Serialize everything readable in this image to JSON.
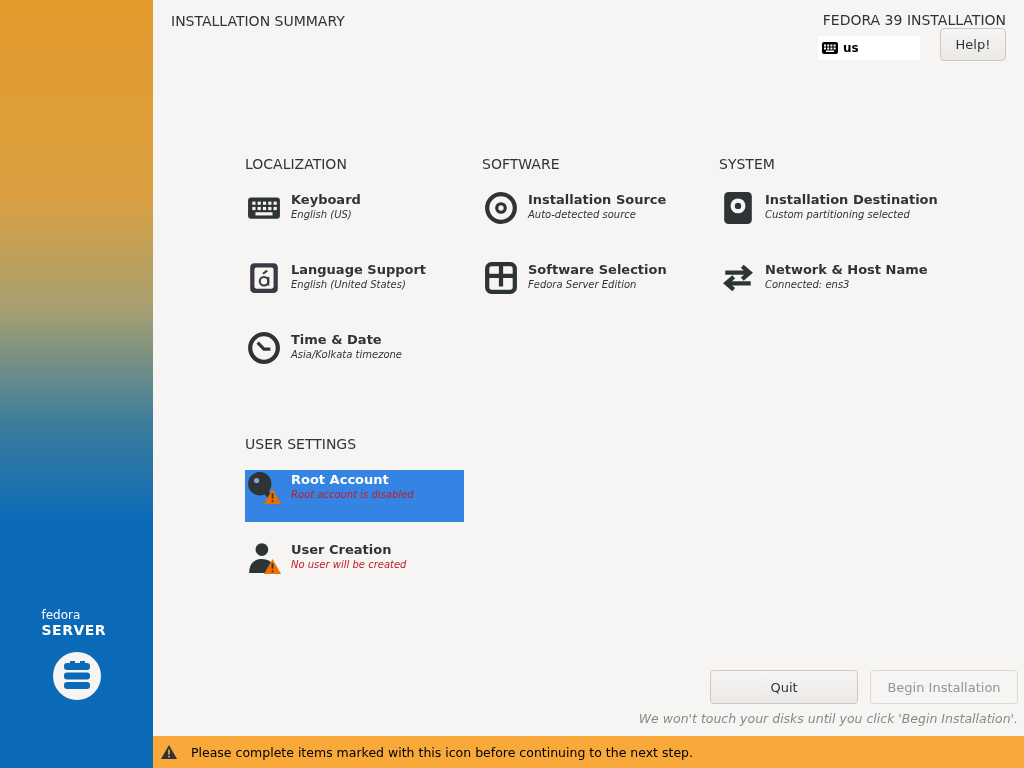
{
  "header": {
    "title": "INSTALLATION SUMMARY",
    "product": "FEDORA 39 INSTALLATION",
    "keyboard_layout": "us",
    "help_button": "Help!"
  },
  "sidebar": {
    "brand": "fedora",
    "edition": "SERVER"
  },
  "sections": [
    {
      "title": "LOCALIZATION",
      "spokes": [
        {
          "kind": "keyboard",
          "title": "Keyboard",
          "status": "English (US)",
          "warning": false,
          "selected": false
        },
        {
          "kind": "language",
          "title": "Language Support",
          "status": "English (United States)",
          "warning": false,
          "selected": false
        },
        {
          "kind": "clock",
          "title": "Time & Date",
          "status": "Asia/Kolkata timezone",
          "warning": false,
          "selected": false
        }
      ]
    },
    {
      "title": "SOFTWARE",
      "spokes": [
        {
          "kind": "disc",
          "title": "Installation Source",
          "status": "Auto-detected source",
          "warning": false,
          "selected": false
        },
        {
          "kind": "package",
          "title": "Software Selection",
          "status": "Fedora Server Edition",
          "warning": false,
          "selected": false
        }
      ]
    },
    {
      "title": "SYSTEM",
      "spokes": [
        {
          "kind": "disk",
          "title": "Installation Destination",
          "status": "Custom partitioning selected",
          "warning": false,
          "selected": false
        },
        {
          "kind": "network",
          "title": "Network & Host Name",
          "status": "Connected: ens3",
          "warning": false,
          "selected": false
        }
      ]
    },
    {
      "title": "USER SETTINGS",
      "spokes": [
        {
          "kind": "key",
          "title": "Root Account",
          "status": "Root account is disabled",
          "warning": true,
          "selected": true
        },
        {
          "kind": "user",
          "title": "User Creation",
          "status": "No user will be created",
          "warning": true,
          "selected": false
        }
      ]
    }
  ],
  "buttons": [
    {
      "label": "Quit",
      "disabled": false
    },
    {
      "label": "Begin Installation",
      "disabled": true
    }
  ],
  "note": "We won't touch your disks until you click 'Begin Installation'.",
  "warning_bar": {
    "message": "Please complete items marked with this icon before continuing to the next step."
  }
}
